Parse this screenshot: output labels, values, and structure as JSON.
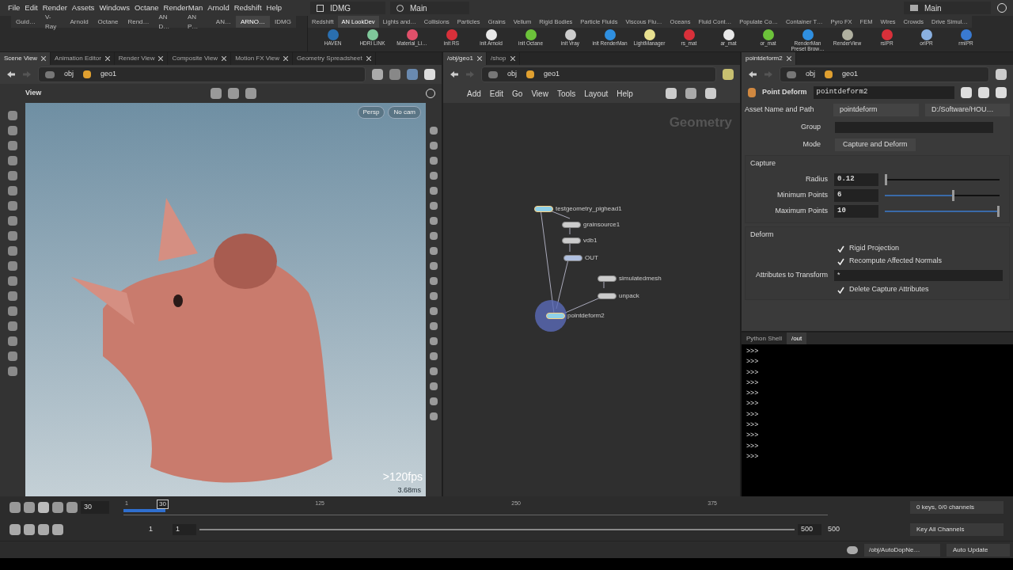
{
  "menu": [
    "File",
    "Edit",
    "Render",
    "Assets",
    "Windows",
    "Octane",
    "RenderMan",
    "Arnold",
    "Redshift",
    "Help"
  ],
  "desktop": {
    "name": "IDMG",
    "context": "Main",
    "right_context": "Main"
  },
  "shelf_tabs_left": [
    {
      "label": "Guid…",
      "selected": false
    },
    {
      "label": "V-Ray",
      "selected": false
    },
    {
      "label": "Arnold",
      "selected": false
    },
    {
      "label": "Octane",
      "selected": false
    },
    {
      "label": "Rend…",
      "selected": false
    },
    {
      "label": "AN D…",
      "selected": false
    },
    {
      "label": "AN P…",
      "selected": false
    },
    {
      "label": "AN…",
      "selected": false
    },
    {
      "label": "ARNO…",
      "selected": true
    },
    {
      "label": "IDMG",
      "selected": false
    }
  ],
  "shelf_tabs_right": [
    {
      "label": "Redshift",
      "selected": false
    },
    {
      "label": "AN LookDev",
      "selected": true
    },
    {
      "label": "Lights and…",
      "selected": false
    },
    {
      "label": "Collisions",
      "selected": false
    },
    {
      "label": "Particles",
      "selected": false
    },
    {
      "label": "Grains",
      "selected": false
    },
    {
      "label": "Vellum",
      "selected": false
    },
    {
      "label": "Rigid Bodies",
      "selected": false
    },
    {
      "label": "Particle Fluids",
      "selected": false
    },
    {
      "label": "Viscous Flu…",
      "selected": false
    },
    {
      "label": "Oceans",
      "selected": false
    },
    {
      "label": "Fluid Cont…",
      "selected": false
    },
    {
      "label": "Populate Co…",
      "selected": false
    },
    {
      "label": "Container T…",
      "selected": false
    },
    {
      "label": "Pyro FX",
      "selected": false
    },
    {
      "label": "FEM",
      "selected": false
    },
    {
      "label": "Wires",
      "selected": false
    },
    {
      "label": "Crowds",
      "selected": false
    },
    {
      "label": "Drive Simul…",
      "selected": false
    }
  ],
  "shelf_tools": [
    {
      "label": "HAVEN",
      "color": "#2a6fb0"
    },
    {
      "label": "HDRI LINK",
      "color": "#7fc89a"
    },
    {
      "label": "Material_Li…",
      "color": "#e0506a"
    },
    {
      "label": "init RS",
      "color": "#d8303a"
    },
    {
      "label": "init Arnold",
      "color": "#e8e8e8"
    },
    {
      "label": "init Octane",
      "color": "#6cc23a"
    },
    {
      "label": "init Vray",
      "color": "#cccccc"
    },
    {
      "label": "init RenderMan",
      "color": "#2f8fe0"
    },
    {
      "label": "LightManager",
      "color": "#e8e090"
    },
    {
      "label": "rs_mat",
      "color": "#d8303a"
    },
    {
      "label": "ar_mat",
      "color": "#e8e8e8"
    },
    {
      "label": "or_mat",
      "color": "#6cc23a"
    },
    {
      "label": "RenderMan Preset Brow…",
      "color": "#2f8fe0"
    },
    {
      "label": "RenderView",
      "color": "#b0b0a0"
    },
    {
      "label": "rsIPR",
      "color": "#d8303a"
    },
    {
      "label": "orIPR",
      "color": "#8ab0e0"
    },
    {
      "label": "rmIPR",
      "color": "#3a7ad0"
    }
  ],
  "left_pane": {
    "tabs": [
      {
        "label": "Scene View",
        "selected": true
      },
      {
        "label": "Animation Editor",
        "selected": false
      },
      {
        "label": "Render View",
        "selected": false
      },
      {
        "label": "Composite View",
        "selected": false
      },
      {
        "label": "Motion FX View",
        "selected": false
      },
      {
        "label": "Geometry Spreadsheet",
        "selected": false
      }
    ],
    "path": [
      "obj",
      "geo1"
    ],
    "toolbar_label": "View",
    "camera_menus": [
      "Persp",
      "No cam"
    ],
    "fps": ">120fps",
    "frame_time": "3.68ms"
  },
  "network_pane": {
    "tabs": [
      {
        "label": "/obj/geo1",
        "selected": true
      },
      {
        "label": "/shop",
        "selected": false
      }
    ],
    "path": [
      "obj",
      "geo1"
    ],
    "menu": [
      "Add",
      "Edit",
      "Go",
      "View",
      "Tools",
      "Layout",
      "Help"
    ],
    "context_label": "Geometry",
    "nodes": [
      {
        "name": "testgeometry_pighead1",
        "selected": true
      },
      {
        "name": "grainsource1",
        "selected": false
      },
      {
        "name": "vdb1",
        "selected": false
      },
      {
        "name": "OUT",
        "selected": false
      },
      {
        "name": "simulatedmesh",
        "selected": false
      },
      {
        "name": "unpack",
        "selected": false
      },
      {
        "name": "pointdeform2",
        "selected": true
      }
    ]
  },
  "param_pane": {
    "tab": "pointdeform2",
    "path": [
      "obj",
      "geo1"
    ],
    "node_type": "Point Deform",
    "node_name": "pointdeform2",
    "asset_label": "Asset Name and Path",
    "asset_name": "pointdeform",
    "asset_path": "D:/Software/HOU…",
    "group_label": "Group",
    "mode_label": "Mode",
    "mode": "Capture and Deform",
    "capture_title": "Capture",
    "sliders": [
      {
        "label": "Radius",
        "value": "0.12",
        "level": 0.0
      },
      {
        "label": "Minimum Points",
        "value": "6",
        "level": 0.6
      },
      {
        "label": "Maximum Points",
        "value": "10",
        "level": 1.0
      }
    ],
    "deform_title": "Deform",
    "checks": [
      {
        "label": "Rigid Projection",
        "checked": true
      },
      {
        "label": "Recompute Affected Normals",
        "checked": true
      }
    ],
    "attr_label": "Attributes to Transform",
    "attr_value": "*",
    "delete_check": {
      "label": "Delete Capture Attributes",
      "checked": true
    }
  },
  "shell": {
    "tabs": [
      {
        "label": "Python Shell",
        "selected": false
      },
      {
        "label": "/out",
        "selected": true
      }
    ],
    "lines": [
      ">>>",
      ">>>",
      ">>>",
      ">>>",
      ">>>",
      ">>>",
      ">>>",
      ">>>",
      ">>>",
      ">>>",
      ">>>"
    ]
  },
  "timeline": {
    "frame": "30",
    "marker": "30",
    "level": 0.06,
    "ticks": [
      "1",
      "125",
      "250",
      "375"
    ],
    "range_start": "1",
    "range_start2": "1",
    "range_end": "500",
    "range_end2": "500",
    "range_bar": {
      "level": 1.0
    },
    "keys": "0 keys, 0/0 channels",
    "key_all": "Key All Channels",
    "status_path": "/obj/AutoDopNe…",
    "update_mode": "Auto Update"
  }
}
